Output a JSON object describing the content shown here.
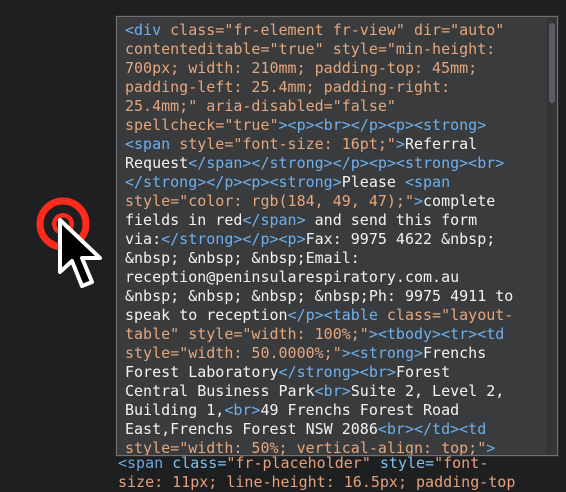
{
  "popup": {
    "lines": [
      [
        {
          "c": "tg",
          "t": "<div "
        },
        {
          "c": "at",
          "t": "class="
        },
        {
          "c": "vl",
          "t": "\"fr-element fr-view\" "
        },
        {
          "c": "at",
          "t": "dir="
        },
        {
          "c": "vl",
          "t": "\"auto\""
        }
      ],
      [
        {
          "c": "at",
          "t": "contenteditable="
        },
        {
          "c": "vl",
          "t": "\"true\" "
        },
        {
          "c": "at",
          "t": "style="
        },
        {
          "c": "vl",
          "t": "\"min-height:"
        }
      ],
      [
        {
          "c": "vl",
          "t": "700px; width: 210mm; padding-top: 45mm;"
        }
      ],
      [
        {
          "c": "vl",
          "t": "padding-left: 25.4mm; padding-right:"
        }
      ],
      [
        {
          "c": "vl",
          "t": "25.4mm;\" "
        },
        {
          "c": "at",
          "t": "aria-disabled="
        },
        {
          "c": "vl",
          "t": "\"false\""
        }
      ],
      [
        {
          "c": "at",
          "t": "spellcheck="
        },
        {
          "c": "vl",
          "t": "\"true\""
        },
        {
          "c": "tg",
          "t": "><p><br></p><p><strong>"
        }
      ],
      [
        {
          "c": "tg",
          "t": "<span "
        },
        {
          "c": "at",
          "t": "style="
        },
        {
          "c": "vl",
          "t": "\"font-size: 16pt;\""
        },
        {
          "c": "tg",
          "t": ">"
        },
        {
          "c": "tx",
          "t": "Referral"
        }
      ],
      [
        {
          "c": "tx",
          "t": "Request"
        },
        {
          "c": "tg",
          "t": "</span></strong></p><p><strong><br>"
        }
      ],
      [
        {
          "c": "tg",
          "t": "</strong></p><p><strong>"
        },
        {
          "c": "tx",
          "t": "Please "
        },
        {
          "c": "tg",
          "t": "<span"
        }
      ],
      [
        {
          "c": "at",
          "t": "style="
        },
        {
          "c": "vl",
          "t": "\"color: rgb(184, 49, 47);\""
        },
        {
          "c": "tg",
          "t": ">"
        },
        {
          "c": "tx",
          "t": "complete"
        }
      ],
      [
        {
          "c": "tx",
          "t": "fields in red"
        },
        {
          "c": "tg",
          "t": "</span>"
        },
        {
          "c": "tx",
          "t": " and send this form"
        }
      ],
      [
        {
          "c": "tx",
          "t": "via:"
        },
        {
          "c": "tg",
          "t": "</strong></p><p>"
        },
        {
          "c": "tx",
          "t": "Fax: 9975 4622 &nbsp;"
        }
      ],
      [
        {
          "c": "tx",
          "t": "&nbsp; &nbsp; &nbsp;Email:"
        }
      ],
      [
        {
          "c": "tx",
          "t": "reception@peninsularespiratory.com.au"
        }
      ],
      [
        {
          "c": "tx",
          "t": "&nbsp; &nbsp; &nbsp; &nbsp;Ph: 9975 4911 to"
        }
      ],
      [
        {
          "c": "tx",
          "t": "speak to reception"
        },
        {
          "c": "tg",
          "t": "</p><table "
        },
        {
          "c": "at",
          "t": "class="
        },
        {
          "c": "vl",
          "t": "\"layout-"
        }
      ],
      [
        {
          "c": "vl",
          "t": "table\" "
        },
        {
          "c": "at",
          "t": "style="
        },
        {
          "c": "vl",
          "t": "\"width: 100%;\""
        },
        {
          "c": "tg",
          "t": "><tbody><tr><td"
        }
      ],
      [
        {
          "c": "at",
          "t": "style="
        },
        {
          "c": "vl",
          "t": "\"width: 50.0000%;\""
        },
        {
          "c": "tg",
          "t": "><strong>"
        },
        {
          "c": "tx",
          "t": "Frenchs"
        }
      ],
      [
        {
          "c": "tx",
          "t": "Forest Laboratory"
        },
        {
          "c": "tg",
          "t": "</strong><br>"
        },
        {
          "c": "tx",
          "t": "Forest"
        }
      ],
      [
        {
          "c": "tx",
          "t": "Central Business Park"
        },
        {
          "c": "tg",
          "t": "<br>"
        },
        {
          "c": "tx",
          "t": "Suite 2, Level 2,"
        }
      ],
      [
        {
          "c": "tx",
          "t": "Building 1,"
        },
        {
          "c": "tg",
          "t": "<br>"
        },
        {
          "c": "tx",
          "t": "49 Frenchs Forest Road"
        }
      ],
      [
        {
          "c": "tx",
          "t": "East,Frenchs Forest NSW 2086"
        },
        {
          "c": "tg",
          "t": "<br></td><td"
        }
      ],
      [
        {
          "c": "at",
          "t": "style="
        },
        {
          "c": "vl",
          "t": "\"width: 50%; vertical-align: top;\""
        },
        {
          "c": "tg",
          "t": ">"
        }
      ]
    ]
  },
  "under": {
    "line1": [
      {
        "c": "t",
        "t": "<span "
      },
      {
        "c": "a",
        "t": "class="
      },
      {
        "c": "v",
        "t": "\"fr-placeholder\" "
      },
      {
        "c": "a",
        "t": "style="
      },
      {
        "c": "v",
        "t": "\"font-"
      }
    ],
    "line2": [
      {
        "c": "v",
        "t": "size: 11px; line-height: 16.5px; padding-top"
      }
    ]
  },
  "colors": {
    "tag": "#6eb0ef",
    "attr": "#e5a77e",
    "text": "#f2f2f2",
    "target_red": "#ff2a1a"
  },
  "icons": {
    "target": "click-target-icon",
    "cursor": "mouse-pointer-icon"
  }
}
